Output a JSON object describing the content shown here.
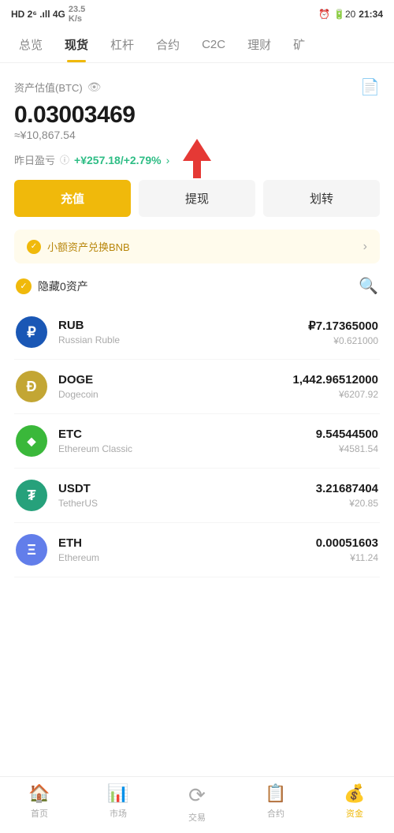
{
  "statusBar": {
    "left": "HD 2⁶ .ıll 4G",
    "speed": "23.5 K/s",
    "time": "21:34",
    "batteryLevel": "20"
  },
  "navTabs": [
    {
      "id": "overview",
      "label": "总览",
      "active": false
    },
    {
      "id": "spot",
      "label": "现货",
      "active": true
    },
    {
      "id": "leverage",
      "label": "杠杆",
      "active": false
    },
    {
      "id": "contract",
      "label": "合约",
      "active": false
    },
    {
      "id": "c2c",
      "label": "C2C",
      "active": false
    },
    {
      "id": "finance",
      "label": "理财",
      "active": false
    },
    {
      "id": "mine",
      "label": "矿",
      "active": false
    }
  ],
  "assetSection": {
    "label": "资产估值(BTC)",
    "btcAmount": "0.03003469",
    "cnyApprox": "≈¥10,867.54",
    "profitLabel": "昨日盈亏",
    "profitValue": "+¥257.18/+2.79%"
  },
  "actionButtons": {
    "recharge": "充值",
    "withdraw": "提现",
    "transfer": "划转"
  },
  "bnbBanner": {
    "text": "小额资产兑换BNB",
    "arrow": "›"
  },
  "filterSection": {
    "label": "隐藏0资产"
  },
  "assets": [
    {
      "id": "rub",
      "symbol": "RUB",
      "fullName": "Russian Ruble",
      "amount": "₽7.17365000",
      "cny": "¥0.621000",
      "iconBg": "#1a57b5",
      "iconText": "₽"
    },
    {
      "id": "doge",
      "symbol": "DOGE",
      "fullName": "Dogecoin",
      "amount": "1,442.96512000",
      "cny": "¥6207.92",
      "iconBg": "#c3a634",
      "iconText": "Ð"
    },
    {
      "id": "etc",
      "symbol": "ETC",
      "fullName": "Ethereum Classic",
      "amount": "9.54544500",
      "cny": "¥4581.54",
      "iconBg": "#3ab83a",
      "iconText": "◆"
    },
    {
      "id": "usdt",
      "symbol": "USDT",
      "fullName": "TetherUS",
      "amount": "3.21687404",
      "cny": "¥20.85",
      "iconBg": "#26a17b",
      "iconText": "₮"
    },
    {
      "id": "eth",
      "symbol": "ETH",
      "fullName": "Ethereum",
      "amount": "0.00051603",
      "cny": "¥11.24",
      "iconBg": "#627eea",
      "iconText": "Ξ"
    }
  ],
  "bottomNav": [
    {
      "id": "home",
      "label": "首页",
      "icon": "⌂",
      "active": false
    },
    {
      "id": "market",
      "label": "市场",
      "icon": "📊",
      "active": false
    },
    {
      "id": "trade",
      "label": "交易",
      "icon": "⟳",
      "active": false
    },
    {
      "id": "contract",
      "label": "合约",
      "icon": "📋",
      "active": false
    },
    {
      "id": "assets",
      "label": "资金",
      "icon": "💰",
      "active": true
    }
  ]
}
